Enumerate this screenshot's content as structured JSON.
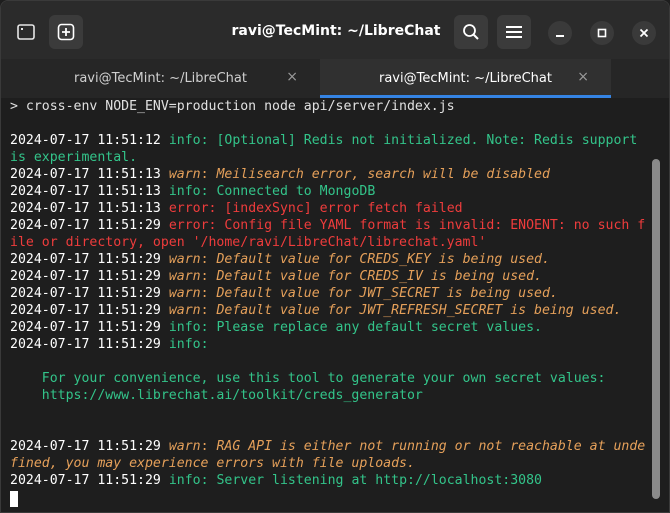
{
  "window": {
    "title": "ravi@TecMint: ~/LibreChat"
  },
  "tabs": [
    {
      "label": "ravi@TecMint: ~/LibreChat",
      "active": false
    },
    {
      "label": "ravi@TecMint: ~/LibreChat",
      "active": true
    }
  ],
  "icons": {
    "terminal": "terminal-icon",
    "new_tab": "new-tab-icon",
    "search": "search-icon",
    "menu": "hamburger-menu-icon",
    "minimize": "minimize-icon",
    "maximize": "maximize-icon",
    "close": "close-icon",
    "tab_close": "×",
    "tab_dropdown": "chevron-down-icon"
  },
  "colors": {
    "info": "#33c48a",
    "warn": "#e5a05a",
    "error": "#ee3c3c",
    "accent": "#3584e4"
  },
  "terminal": {
    "command": "> cross-env NODE_ENV=production node api/server/index.js",
    "logs": [
      {
        "ts": "2024-07-17 11:51:12",
        "level": "info",
        "message": "[Optional] Redis not initialized. Note: Redis support"
      },
      {
        "cont": "is experimental.",
        "level": "info"
      },
      {
        "ts": "2024-07-17 11:51:13",
        "level": "warn",
        "message": "Meilisearch error, search will be disabled"
      },
      {
        "ts": "2024-07-17 11:51:13",
        "level": "info",
        "message": "Connected to MongoDB"
      },
      {
        "ts": "2024-07-17 11:51:13",
        "level": "error",
        "message": "[indexSync] error fetch failed"
      },
      {
        "ts": "2024-07-17 11:51:29",
        "level": "error",
        "message": "Config file YAML format is invalid: ENOENT: no such f"
      },
      {
        "cont": "ile or directory, open '/home/ravi/LibreChat/librechat.yaml'",
        "level": "error"
      },
      {
        "ts": "2024-07-17 11:51:29",
        "level": "warn",
        "message": "Default value for CREDS_KEY is being used."
      },
      {
        "ts": "2024-07-17 11:51:29",
        "level": "warn",
        "message": "Default value for CREDS_IV is being used."
      },
      {
        "ts": "2024-07-17 11:51:29",
        "level": "warn",
        "message": "Default value for JWT_SECRET is being used."
      },
      {
        "ts": "2024-07-17 11:51:29",
        "level": "warn",
        "message": "Default value for JWT_REFRESH_SECRET is being used."
      },
      {
        "ts": "2024-07-17 11:51:29",
        "level": "info",
        "message": "Please replace any default secret values."
      },
      {
        "ts": "2024-07-17 11:51:29",
        "level": "info",
        "message": ""
      },
      {
        "note": "    For your convenience, use this tool to generate your own secret values:"
      },
      {
        "note": "    https://www.librechat.ai/toolkit/creds_generator"
      },
      {
        "ts": "2024-07-17 11:51:29",
        "level": "warn",
        "message": "RAG API is either not running or not reachable at unde"
      },
      {
        "cont": "fined, you may experience errors with file uploads.",
        "level": "warn"
      },
      {
        "ts": "2024-07-17 11:51:29",
        "level": "info",
        "message": "Server listening at http://localhost:3080"
      }
    ]
  }
}
